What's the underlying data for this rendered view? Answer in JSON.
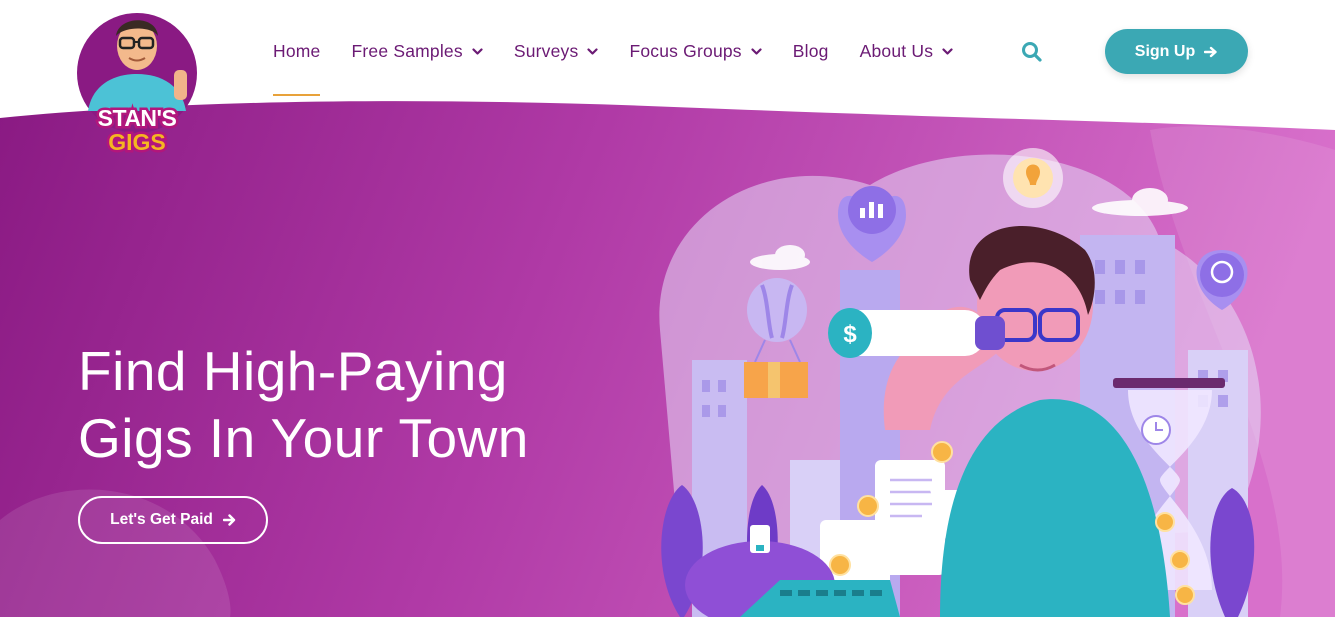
{
  "brand": {
    "logo_line1": "STAN'S",
    "logo_line2": "GIGS"
  },
  "nav": {
    "items": [
      {
        "label": "Home",
        "has_dropdown": false,
        "active": true
      },
      {
        "label": "Free Samples",
        "has_dropdown": true,
        "active": false
      },
      {
        "label": "Surveys",
        "has_dropdown": true,
        "active": false
      },
      {
        "label": "Focus Groups",
        "has_dropdown": true,
        "active": false
      },
      {
        "label": "Blog",
        "has_dropdown": false,
        "active": false
      },
      {
        "label": "About Us",
        "has_dropdown": true,
        "active": false
      }
    ],
    "search_icon": "search-icon",
    "signup_label": "Sign Up",
    "signup_icon": "arrow-right-icon"
  },
  "hero": {
    "title_line1": "Find High-Paying",
    "title_line2": "Gigs In Your Town",
    "cta_label": "Let's Get Paid",
    "cta_icon": "arrow-right-icon"
  },
  "colors": {
    "nav_text": "#6b1a74",
    "active_underline": "#e8a23a",
    "signup_bg": "#3ba8b4",
    "hero_start": "#8e1e86",
    "hero_end": "#d46cc8"
  }
}
